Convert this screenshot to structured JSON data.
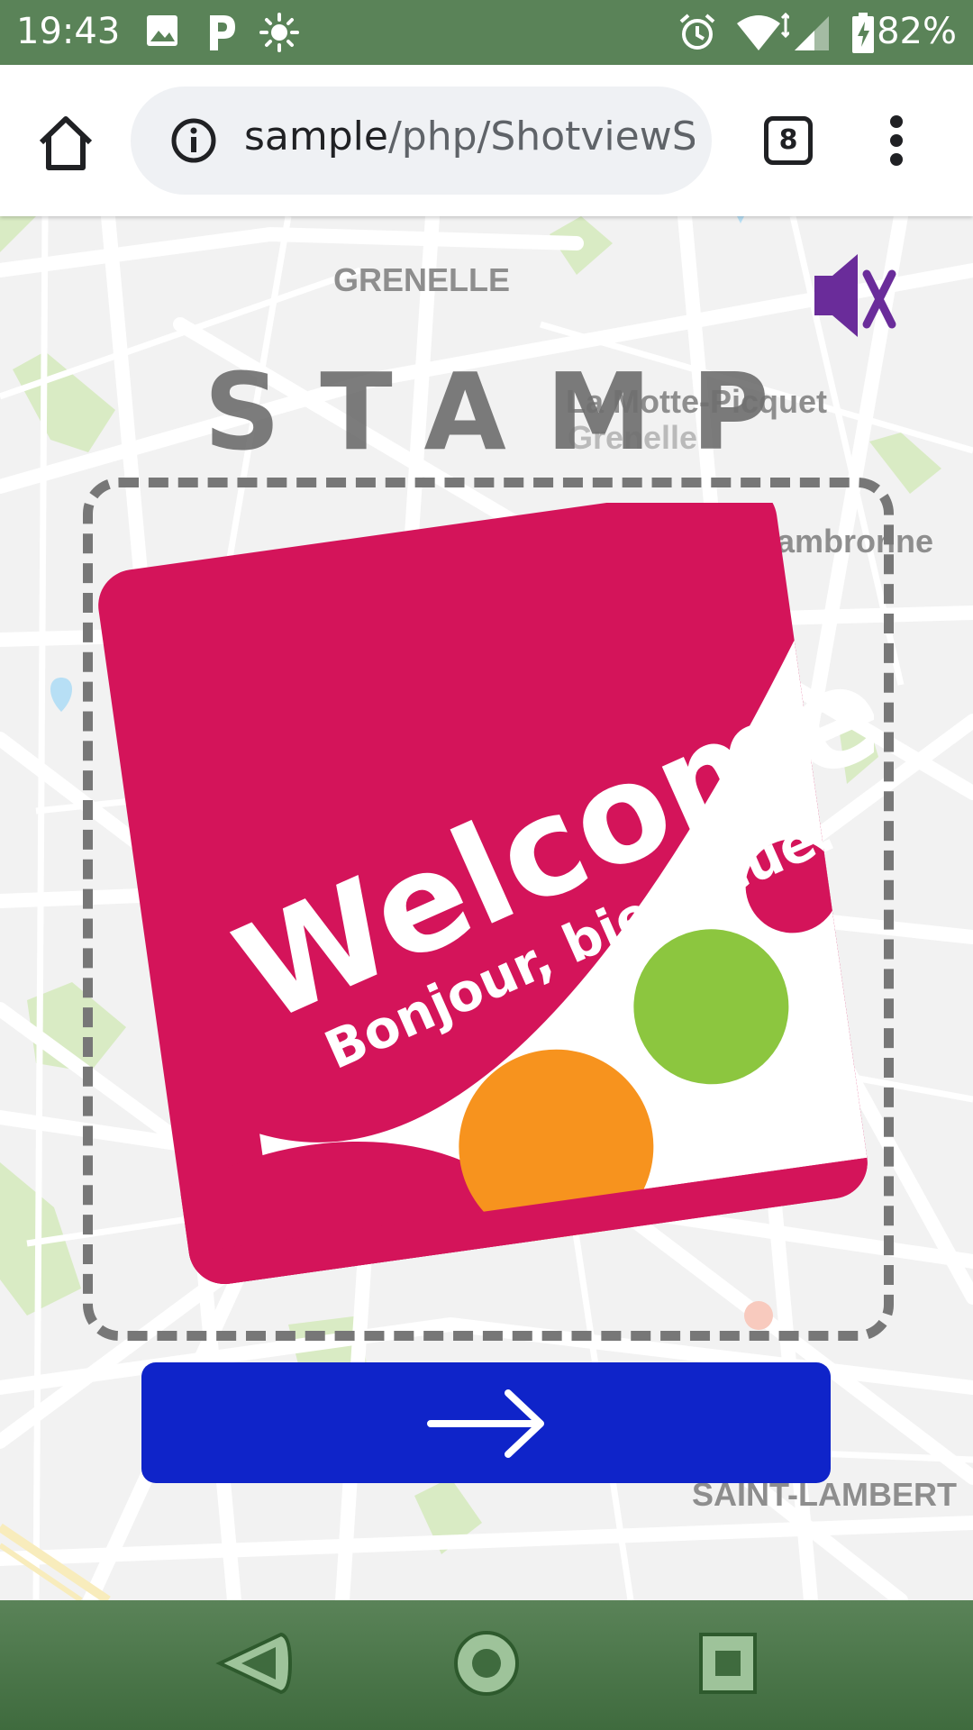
{
  "status_bar": {
    "time": "19:43",
    "battery": "82%",
    "icons": [
      "image-icon",
      "parking-icon",
      "brightness-icon",
      "alarm-icon",
      "wifi-icon",
      "signal-icon",
      "battery-charging-icon"
    ]
  },
  "browser": {
    "url_host": "sample",
    "url_path": "/php/ShotviewS",
    "tab_count": "8"
  },
  "map": {
    "labels": {
      "grenelle": "GRENELLE",
      "la_motte": "La Motte-Picquet",
      "grenelle2": "Grenelle",
      "cambronne": "Cambronne",
      "saint_lambert": "SAINT-LAMBERT"
    }
  },
  "stamp": {
    "title": "STAMP",
    "welcome": "Welcome",
    "subtitle": "Bonjour, bienveue."
  },
  "colors": {
    "status_bar": "#5a8358",
    "stamp_magenta": "#d4145a",
    "stamp_orange": "#f7931e",
    "stamp_green": "#8cc63f",
    "button_blue": "#0f24c9",
    "mute_purple": "#6a2c9a"
  },
  "nav": {
    "icons": [
      "back-icon",
      "home-circle-icon",
      "recents-icon"
    ]
  }
}
